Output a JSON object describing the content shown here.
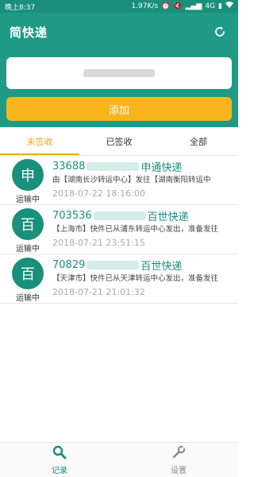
{
  "status_bar": {
    "time": "晚上8:37",
    "speed": "1.97K/s",
    "network": "4G",
    "icons": [
      "alarm-icon",
      "mute-icon",
      "signal-icon",
      "battery-icon",
      "wifi-icon"
    ]
  },
  "header": {
    "title": "简快递",
    "refresh_icon": "refresh-icon"
  },
  "search": {
    "placeholder": ""
  },
  "add_button": {
    "label": "添加"
  },
  "tabs": [
    {
      "label": "未签收",
      "active": true
    },
    {
      "label": "已签收",
      "active": false
    },
    {
      "label": "全部",
      "active": false
    }
  ],
  "items": [
    {
      "logo": "申",
      "status": "运输中",
      "tracking_prefix": "33688",
      "carrier": "申通快递",
      "detail_pre": "由【湖南长沙转运中心】发往【湖南衡阳转运中",
      "detail_post": "",
      "time": "2018-07-22 18:16:00"
    },
    {
      "logo": "百",
      "status": "运输中",
      "tracking_prefix": "703536",
      "carrier": "百世快递",
      "detail_pre": "【上海市】快件已从浦东转运中心发出，准备发往",
      "detail_post": "",
      "time": "2018-07-21 23:51:15"
    },
    {
      "logo": "百",
      "status": "运输中",
      "tracking_prefix": "70829",
      "carrier": "百世快递",
      "detail_pre": "【天津市】快件已从天津转运中心发出，准备发往",
      "detail_post": "",
      "time": "2018-07-21 21:01:32"
    }
  ],
  "bottom_nav": [
    {
      "label": "记录",
      "icon": "search-icon",
      "active": true
    },
    {
      "label": "设置",
      "icon": "wrench-icon",
      "active": false
    }
  ],
  "colors": {
    "primary": "#1f9b85",
    "accent": "#f9b51b",
    "tab_active": "#f0a81c"
  }
}
